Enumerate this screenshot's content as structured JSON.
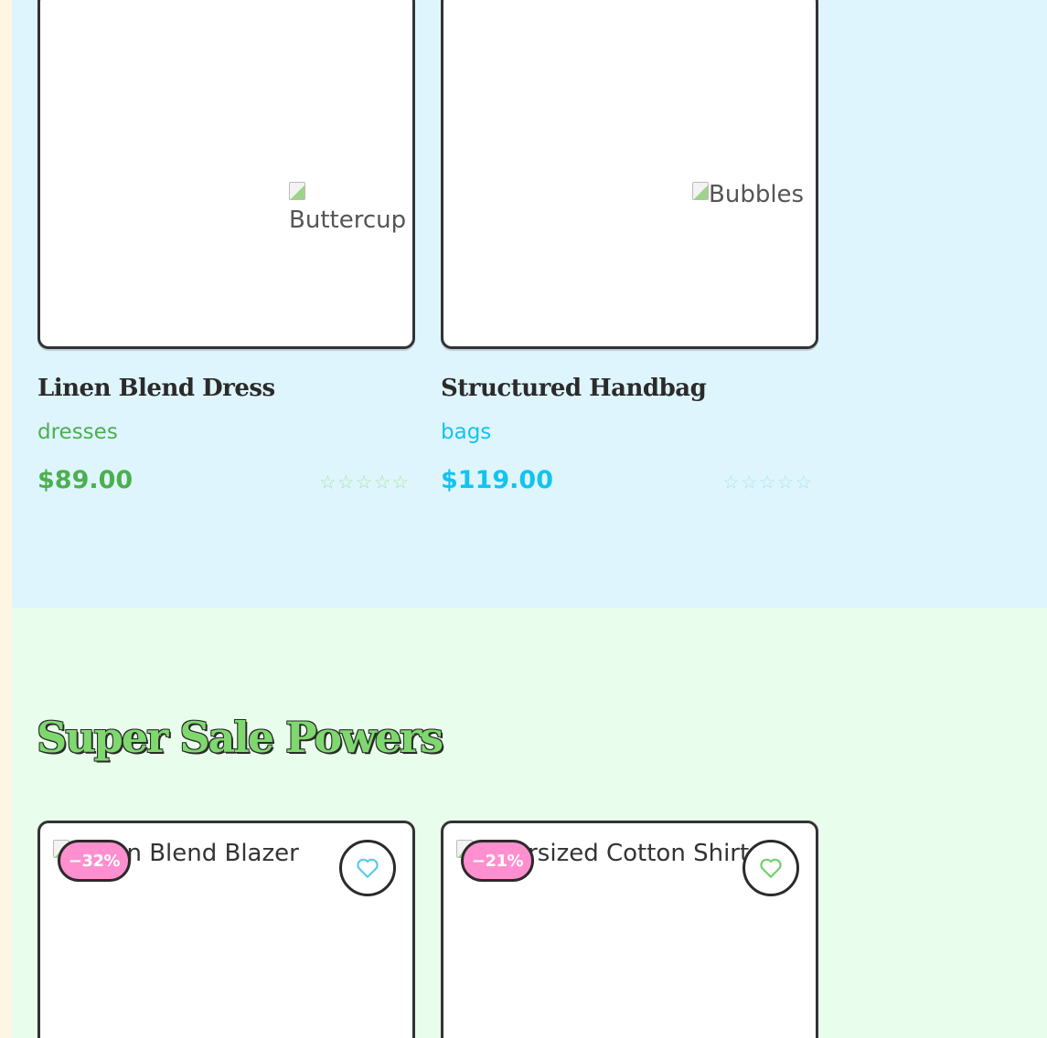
{
  "products": [
    {
      "image_alt": "Buttercup",
      "name": "Linen Blend Dress",
      "category": "dresses",
      "price": "$89.00",
      "rating": 0,
      "accent_color": "#4caf50"
    },
    {
      "image_alt": "Bubbles",
      "name": "Structured Handbag",
      "category": "bags",
      "price": "$119.00",
      "rating": 0,
      "accent_color": "#12c4ee"
    }
  ],
  "sale": {
    "title": "Super Sale Powers",
    "items": [
      {
        "image_alt": "Linen Blend Blazer",
        "discount": "−32%",
        "wishlist_icon": "heart-icon",
        "heart_color": "#5bc8ec"
      },
      {
        "image_alt": "Oversized Cotton Shirt",
        "discount": "−21%",
        "wishlist_icon": "heart-icon",
        "heart_color": "#6fd16a"
      }
    ]
  },
  "colors": {
    "top_section_bg": "#dff5fd",
    "sale_section_bg": "#e8fdec",
    "badge_bg": "#ff8fcf",
    "border": "#333333"
  }
}
